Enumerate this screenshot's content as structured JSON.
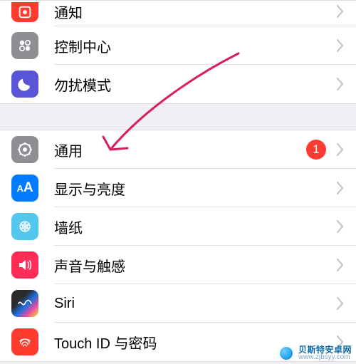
{
  "groups": [
    {
      "rows": [
        {
          "key": "notifications",
          "label": "通知",
          "iconClass": "ic-notifications"
        },
        {
          "key": "control-center",
          "label": "控制中心",
          "iconClass": "ic-control"
        },
        {
          "key": "dnd",
          "label": "勿扰模式",
          "iconClass": "ic-dnd"
        }
      ]
    },
    {
      "rows": [
        {
          "key": "general",
          "label": "通用",
          "iconClass": "ic-general",
          "badge": "1"
        },
        {
          "key": "display",
          "label": "显示与亮度",
          "iconClass": "ic-display"
        },
        {
          "key": "wallpaper",
          "label": "墙纸",
          "iconClass": "ic-wallpaper"
        },
        {
          "key": "sound",
          "label": "声音与触感",
          "iconClass": "ic-sound"
        },
        {
          "key": "siri",
          "label": "Siri",
          "iconClass": "ic-siri"
        },
        {
          "key": "touchid",
          "label": "Touch ID 与密码",
          "iconClass": "ic-touchid"
        }
      ]
    }
  ],
  "watermark": {
    "line1": "贝斯特安卓网",
    "line2": "www.zjbsyy.com"
  }
}
